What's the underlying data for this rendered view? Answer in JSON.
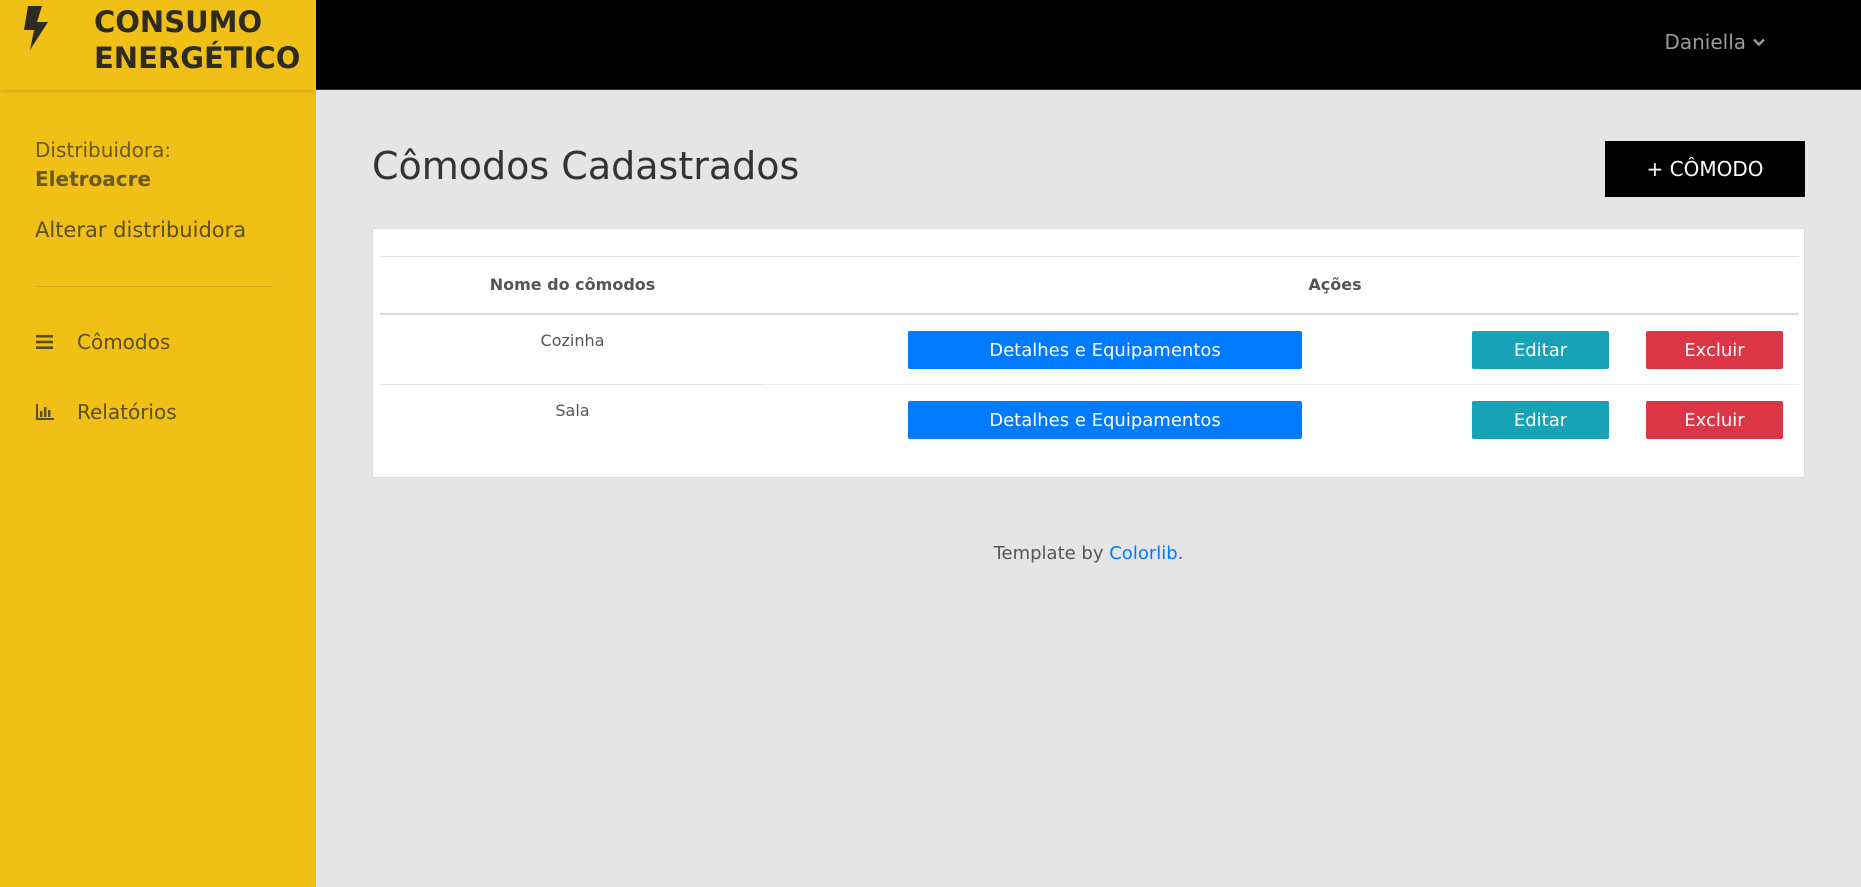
{
  "brand": {
    "line1": "CONSUMO",
    "line2": "ENERGÉTICO",
    "icon": "bolt-icon"
  },
  "sidebar": {
    "distributor_label": "Distribuidora:",
    "distributor_name": "Eletroacre",
    "change_distributor": "Alterar distribuidora",
    "items": [
      {
        "label": "Cômodos",
        "icon": "list-icon"
      },
      {
        "label": "Relatórios",
        "icon": "bar-chart-icon"
      }
    ]
  },
  "topbar": {
    "user": "Daniella",
    "user_icon": "chevron-down-icon"
  },
  "main": {
    "title": "Cômodos Cadastrados",
    "add_button": "+ CÔMODO",
    "table": {
      "headers": [
        "Nome do cômodos",
        "Ações"
      ],
      "rows": [
        {
          "name": "Cozinha",
          "details": "Detalhes e Equipamentos",
          "edit": "Editar",
          "delete": "Excluir"
        },
        {
          "name": "Sala",
          "details": "Detalhes e Equipamentos",
          "edit": "Editar",
          "delete": "Excluir"
        }
      ]
    }
  },
  "footer": {
    "prefix": "Template by ",
    "link": "Colorlib",
    "suffix": "."
  },
  "colors": {
    "sidebar": "#f1c016",
    "topbar": "#000000",
    "primary": "#007bff",
    "info": "#17a2b8",
    "danger": "#dc3545"
  }
}
